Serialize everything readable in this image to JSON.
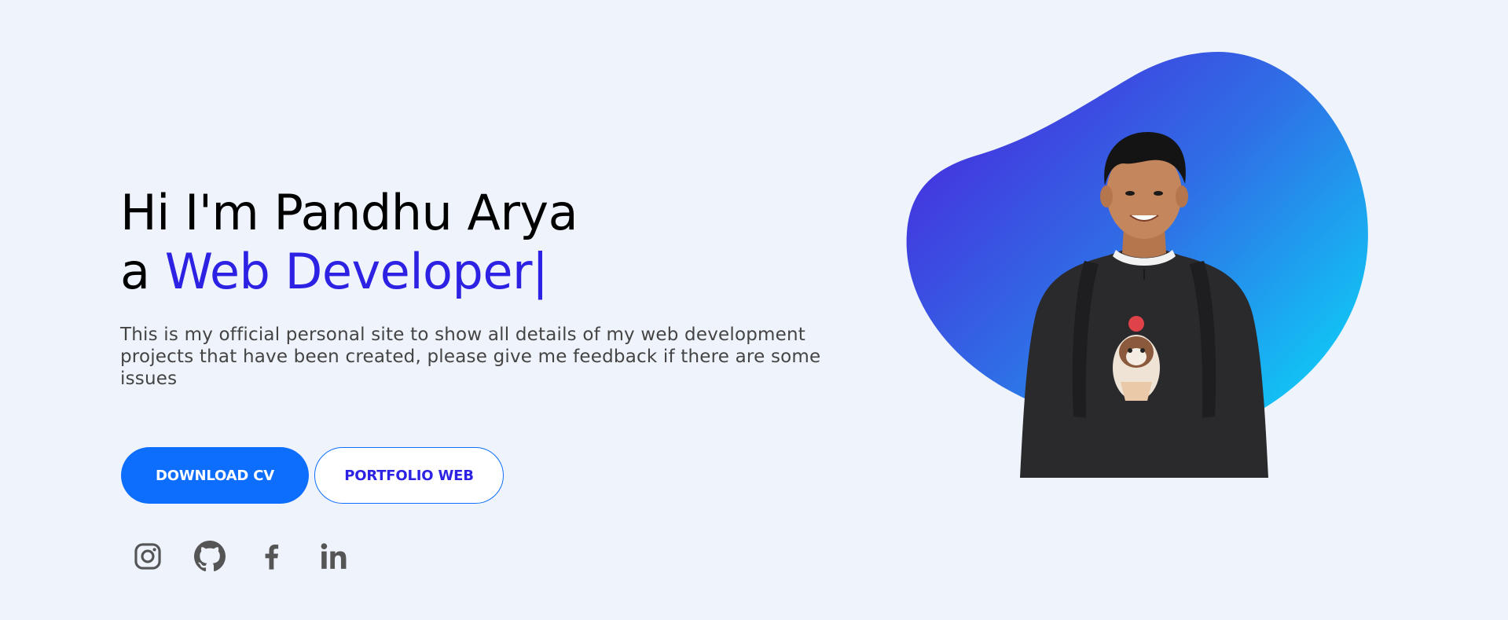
{
  "hero": {
    "greeting_line": "Hi I'm Pandhu Arya",
    "role_prefix": "a",
    "role": "Web Developer",
    "cursor": "|",
    "description": "This is my official personal site to show all details of my web development projects that have been created, please give me feedback if there are some issues"
  },
  "buttons": {
    "download_cv": "DOWNLOAD CV",
    "portfolio_web": "PORTFOLIO WEB"
  },
  "social_icons": [
    "instagram-icon",
    "github-icon",
    "facebook-icon",
    "linkedin-icon"
  ],
  "colors": {
    "background": "#eff4fc",
    "accent_text": "#2d22e3",
    "primary_button": "#0d6efd",
    "blob_gradient_start": "#4a2ee0",
    "blob_gradient_end": "#0fd0f7",
    "icon_gray": "#555555"
  }
}
